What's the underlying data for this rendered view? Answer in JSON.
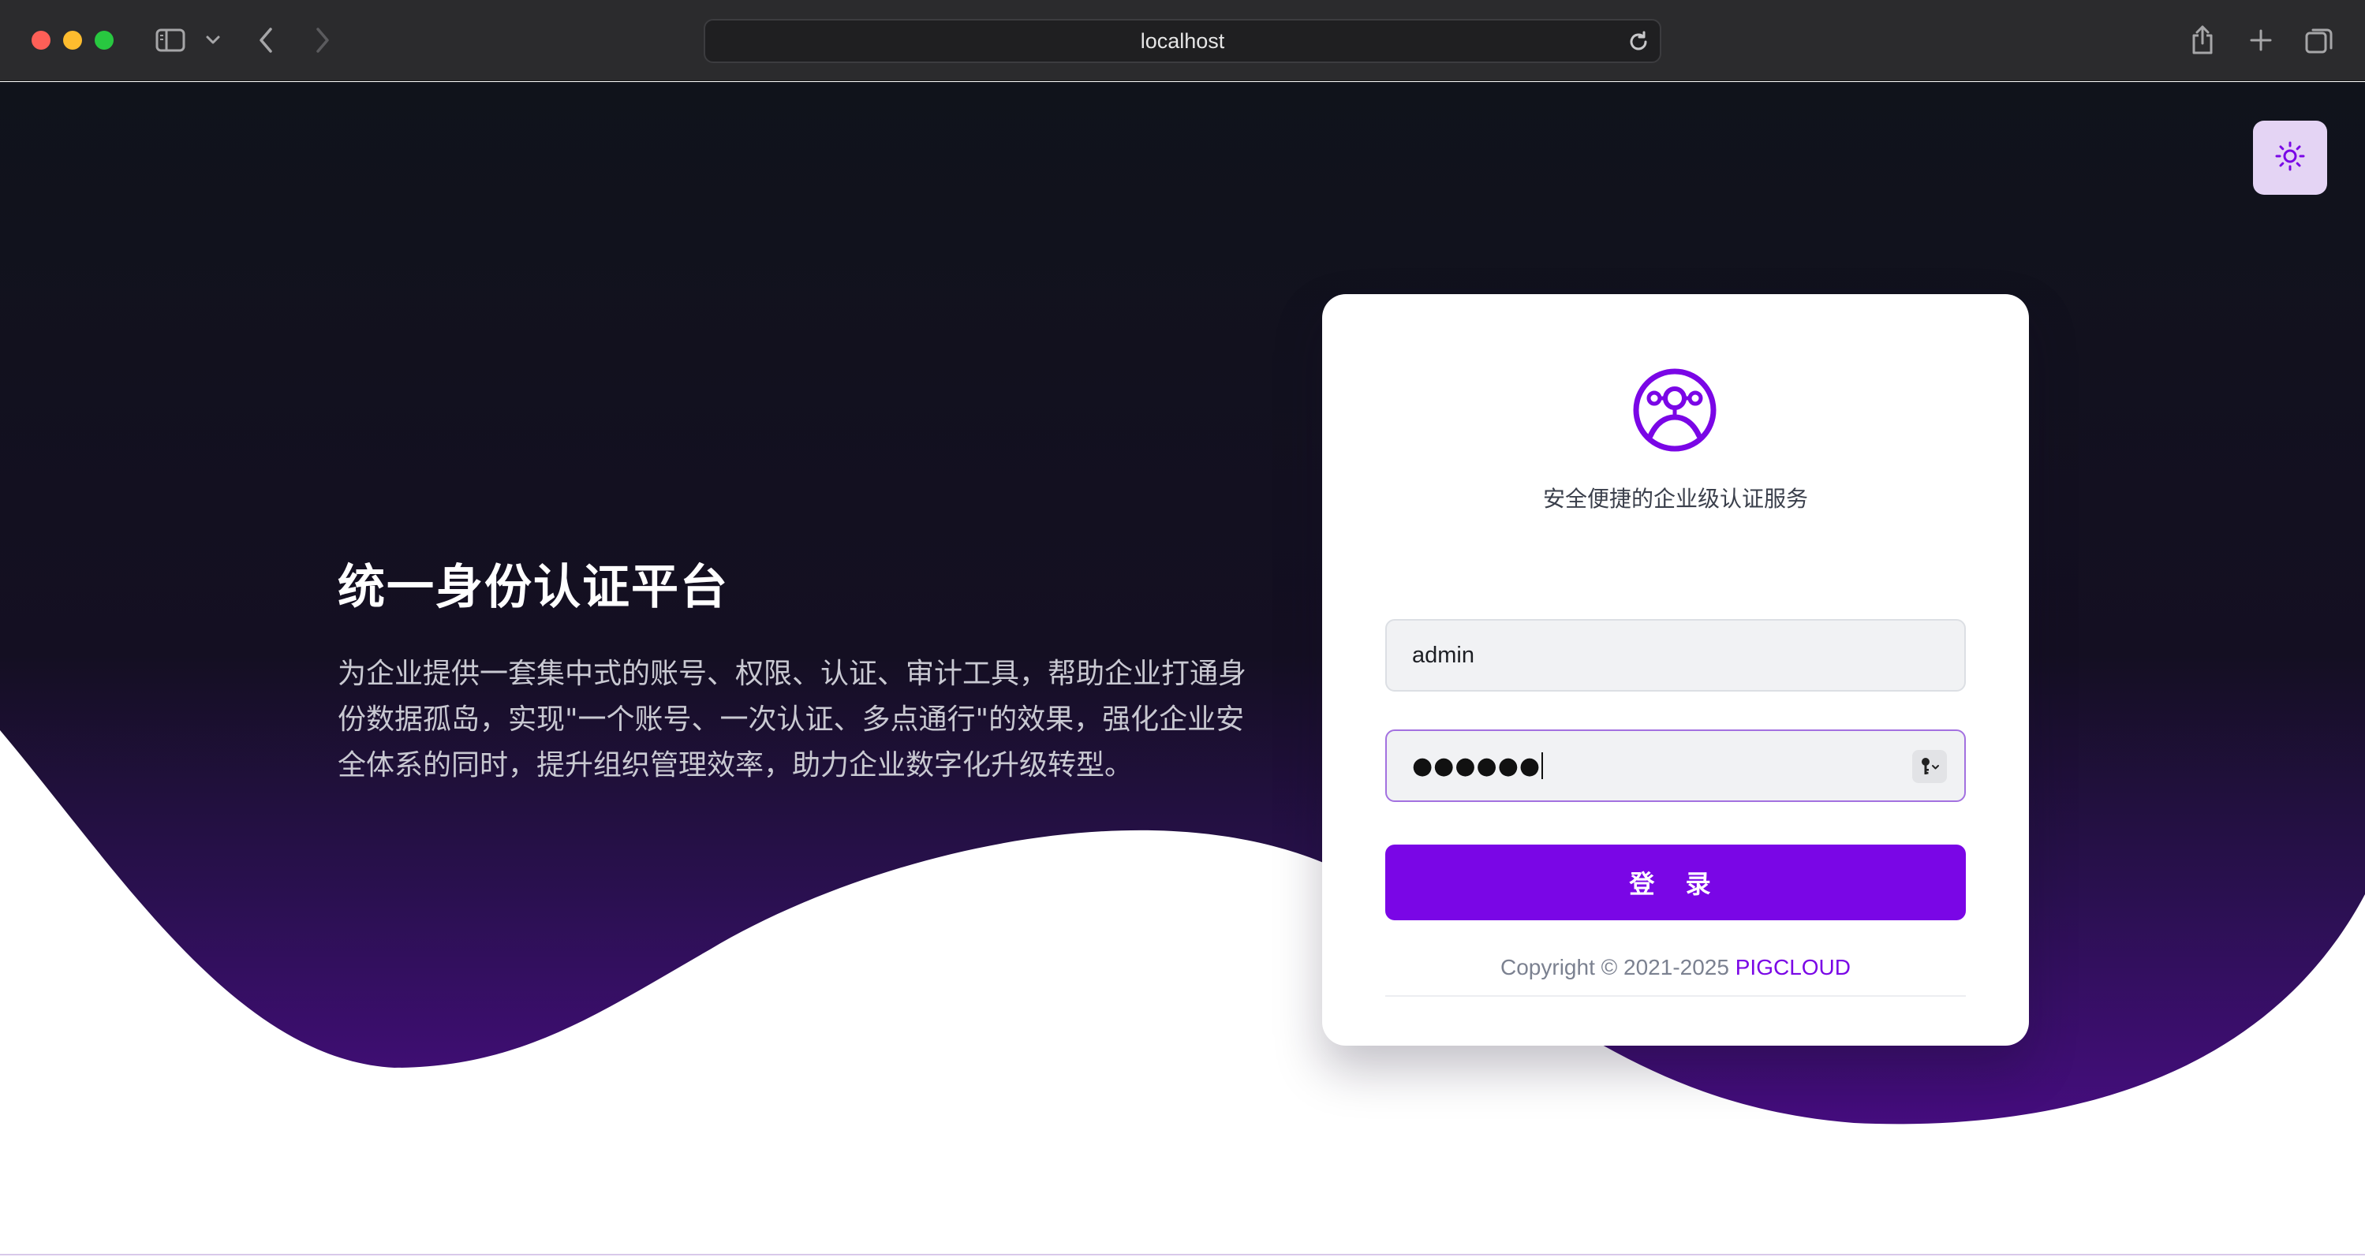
{
  "browser": {
    "url": "localhost",
    "icons": {
      "sidebar": "sidebar-icon",
      "tab_overview_toggle": "chevron-down-icon",
      "back": "chevron-left-icon",
      "forward": "chevron-right-icon",
      "reload": "reload-icon",
      "share": "share-icon",
      "new_tab": "plus-icon",
      "tabs": "tabs-overview-icon"
    }
  },
  "hero": {
    "title": "统一身份认证平台",
    "description": "为企业提供一套集中式的账号、权限、认证、审计工具，帮助企业打通身份数据孤岛，实现\"一个账号、一次认证、多点通行\"的效果，强化企业安全体系的同时，提升组织管理效率，助力企业数字化升级转型。"
  },
  "theme_toggle": {
    "icon": "sun-icon"
  },
  "login": {
    "logo_icon": "user-network-logo-icon",
    "subtitle": "安全便捷的企业级认证服务",
    "username_value": "admin",
    "password_masked": "●●●●●●",
    "password_key_icon": "key-icon",
    "submit_label": "登 录",
    "copyright_prefix": "Copyright © 2021-2025 ",
    "copyright_brand": "PIGCLOUD"
  },
  "colors": {
    "accent": "#7a06e6",
    "hero_bg_top": "#11131d",
    "hero_bg_bottom": "#3f0b72",
    "toggle_bg": "#e4d4f4"
  }
}
